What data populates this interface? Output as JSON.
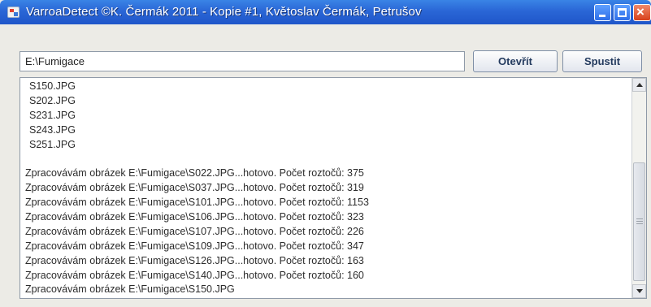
{
  "window": {
    "title": "VarroaDetect ©K. Čermák 2011 - Kopie #1, Květoslav Čermák, Petrušov",
    "controls": {
      "minimize": "minimize-icon",
      "maximize": "maximize-icon",
      "close": "close-icon"
    }
  },
  "toolbar": {
    "path_value": "E:\\Fumigace",
    "open_label": "Otevřít",
    "run_label": "Spustit"
  },
  "log": {
    "file_lines": [
      "S150.JPG",
      "S202.JPG",
      "S231.JPG",
      "S243.JPG",
      "S251.JPG"
    ],
    "blank_line": "",
    "process_lines": [
      "Zpracovávám obrázek E:\\Fumigace\\S022.JPG...hotovo. Počet roztočů: 375",
      "Zpracovávám obrázek E:\\Fumigace\\S037.JPG...hotovo. Počet roztočů: 319",
      "Zpracovávám obrázek E:\\Fumigace\\S101.JPG...hotovo. Počet roztočů: 1153",
      "Zpracovávám obrázek E:\\Fumigace\\S106.JPG...hotovo. Počet roztočů: 323",
      "Zpracovávám obrázek E:\\Fumigace\\S107.JPG...hotovo. Počet roztočů: 226",
      "Zpracovávám obrázek E:\\Fumigace\\S109.JPG...hotovo. Počet roztočů: 347",
      "Zpracovávám obrázek E:\\Fumigace\\S126.JPG...hotovo. Počet roztočů: 163",
      "Zpracovávám obrázek E:\\Fumigace\\S140.JPG...hotovo. Počet roztočů: 160",
      "Zpracovávám obrázek E:\\Fumigace\\S150.JPG"
    ]
  }
}
